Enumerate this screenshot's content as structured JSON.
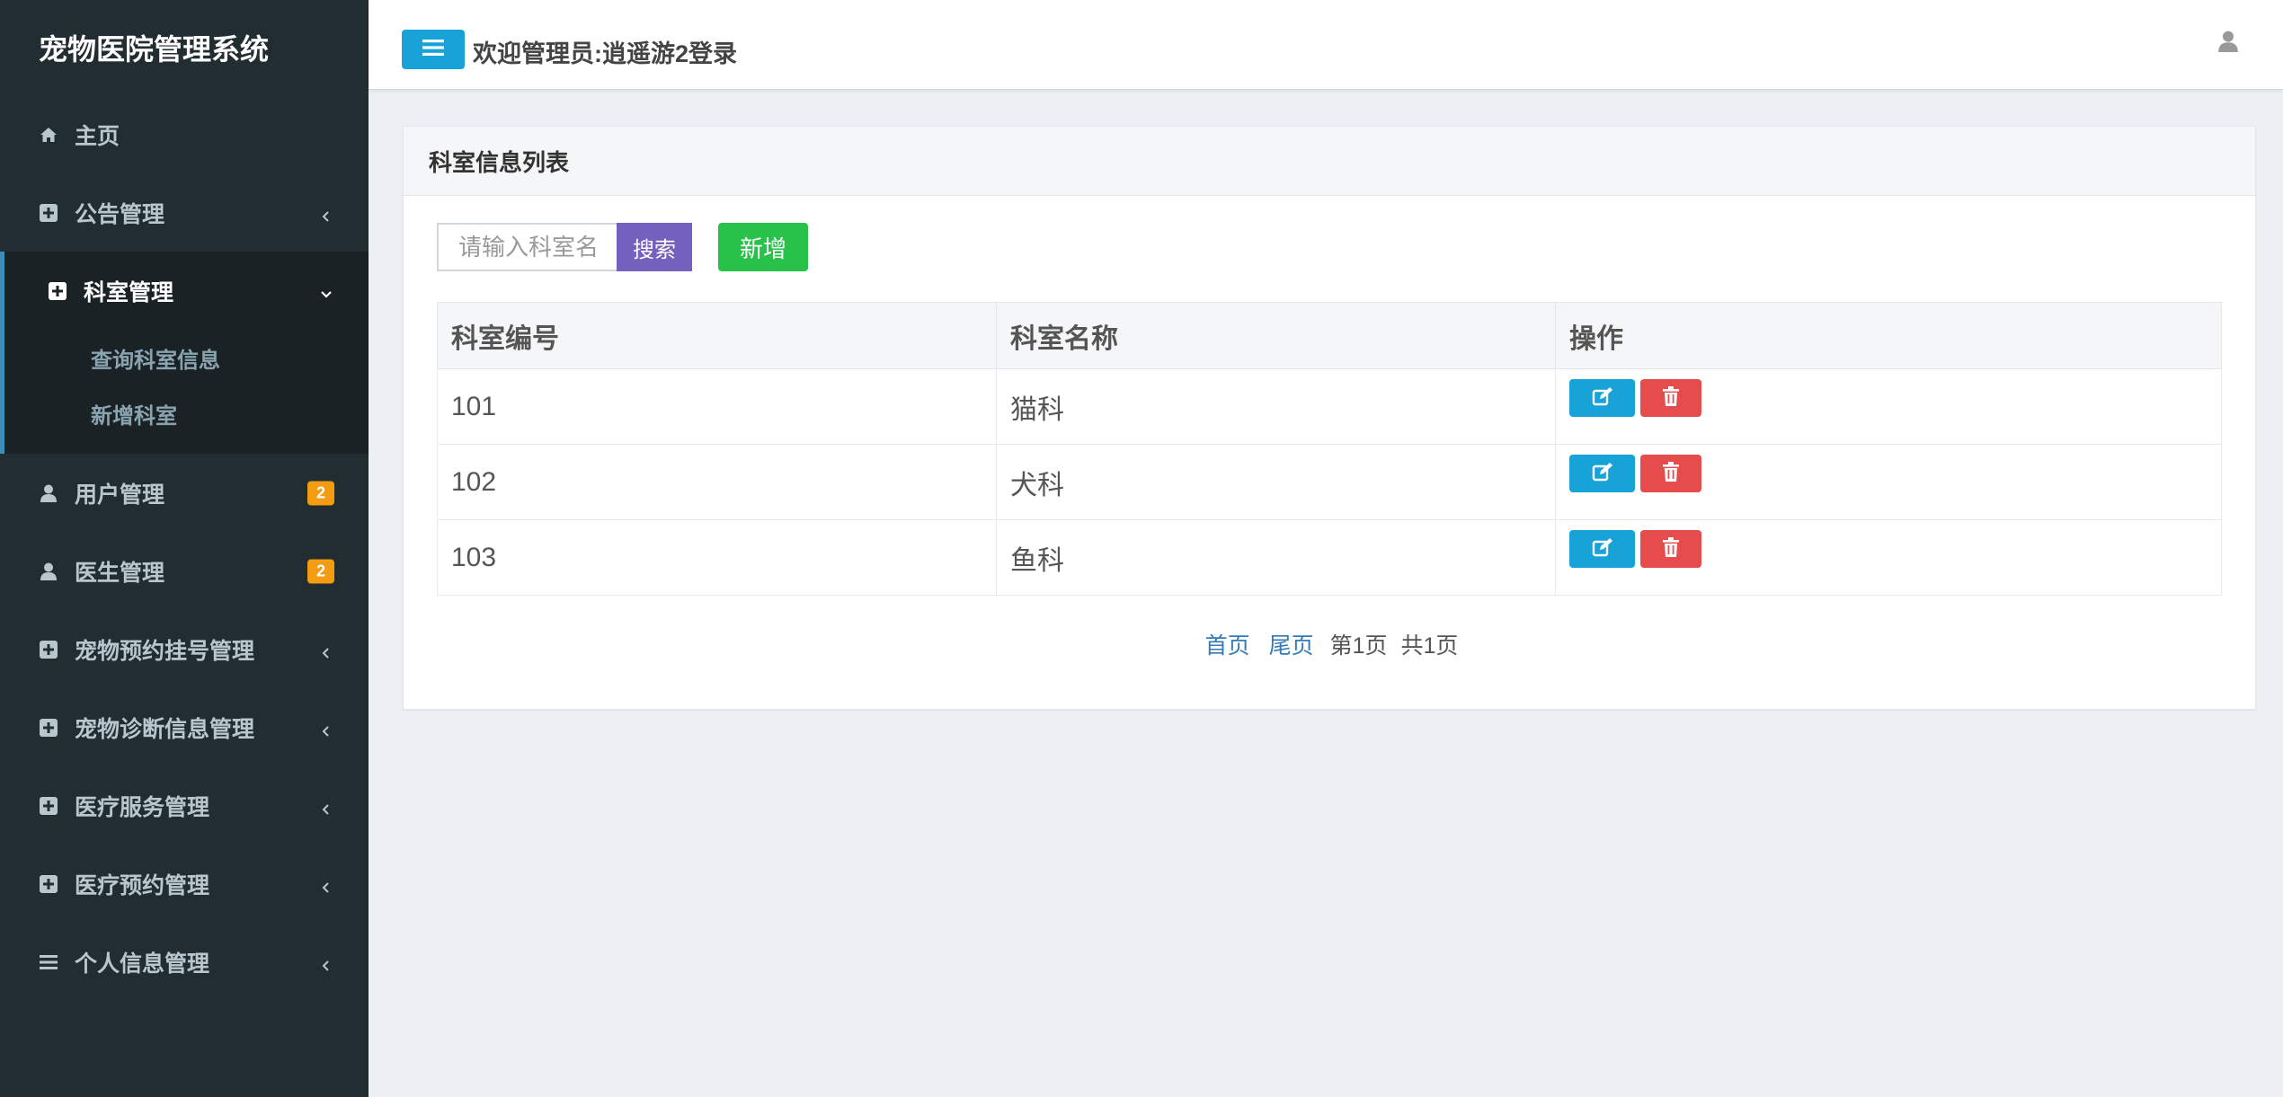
{
  "brand": "宠物医院管理系统",
  "header": {
    "welcome": "欢迎管理员:逍遥游2登录"
  },
  "sidebar": {
    "items": [
      {
        "label": "主页"
      },
      {
        "label": "公告管理"
      },
      {
        "label": "科室管理",
        "sub": [
          "查询科室信息",
          "新增科室"
        ]
      },
      {
        "label": "用户管理",
        "badge": "2"
      },
      {
        "label": "医生管理",
        "badge": "2"
      },
      {
        "label": "宠物预约挂号管理"
      },
      {
        "label": "宠物诊断信息管理"
      },
      {
        "label": "医疗服务管理"
      },
      {
        "label": "医疗预约管理"
      },
      {
        "label": "个人信息管理"
      }
    ]
  },
  "panel": {
    "title": "科室信息列表",
    "search_placeholder": "请输入科室名",
    "search_label": "搜索",
    "add_label": "新增"
  },
  "table": {
    "headers": [
      "科室编号",
      "科室名称",
      "操作"
    ],
    "rows": [
      {
        "id": "101",
        "name": "猫科"
      },
      {
        "id": "102",
        "name": "犬科"
      },
      {
        "id": "103",
        "name": "鱼科"
      }
    ]
  },
  "pager": {
    "first": "首页",
    "last": "尾页",
    "current": "第1页",
    "total": "共1页"
  },
  "colors": {
    "sidebar": "#222d32",
    "accent": "#17a2d8",
    "search": "#7461bd",
    "add": "#28c24b",
    "delete": "#e74c4c",
    "badge": "#f39c12"
  }
}
